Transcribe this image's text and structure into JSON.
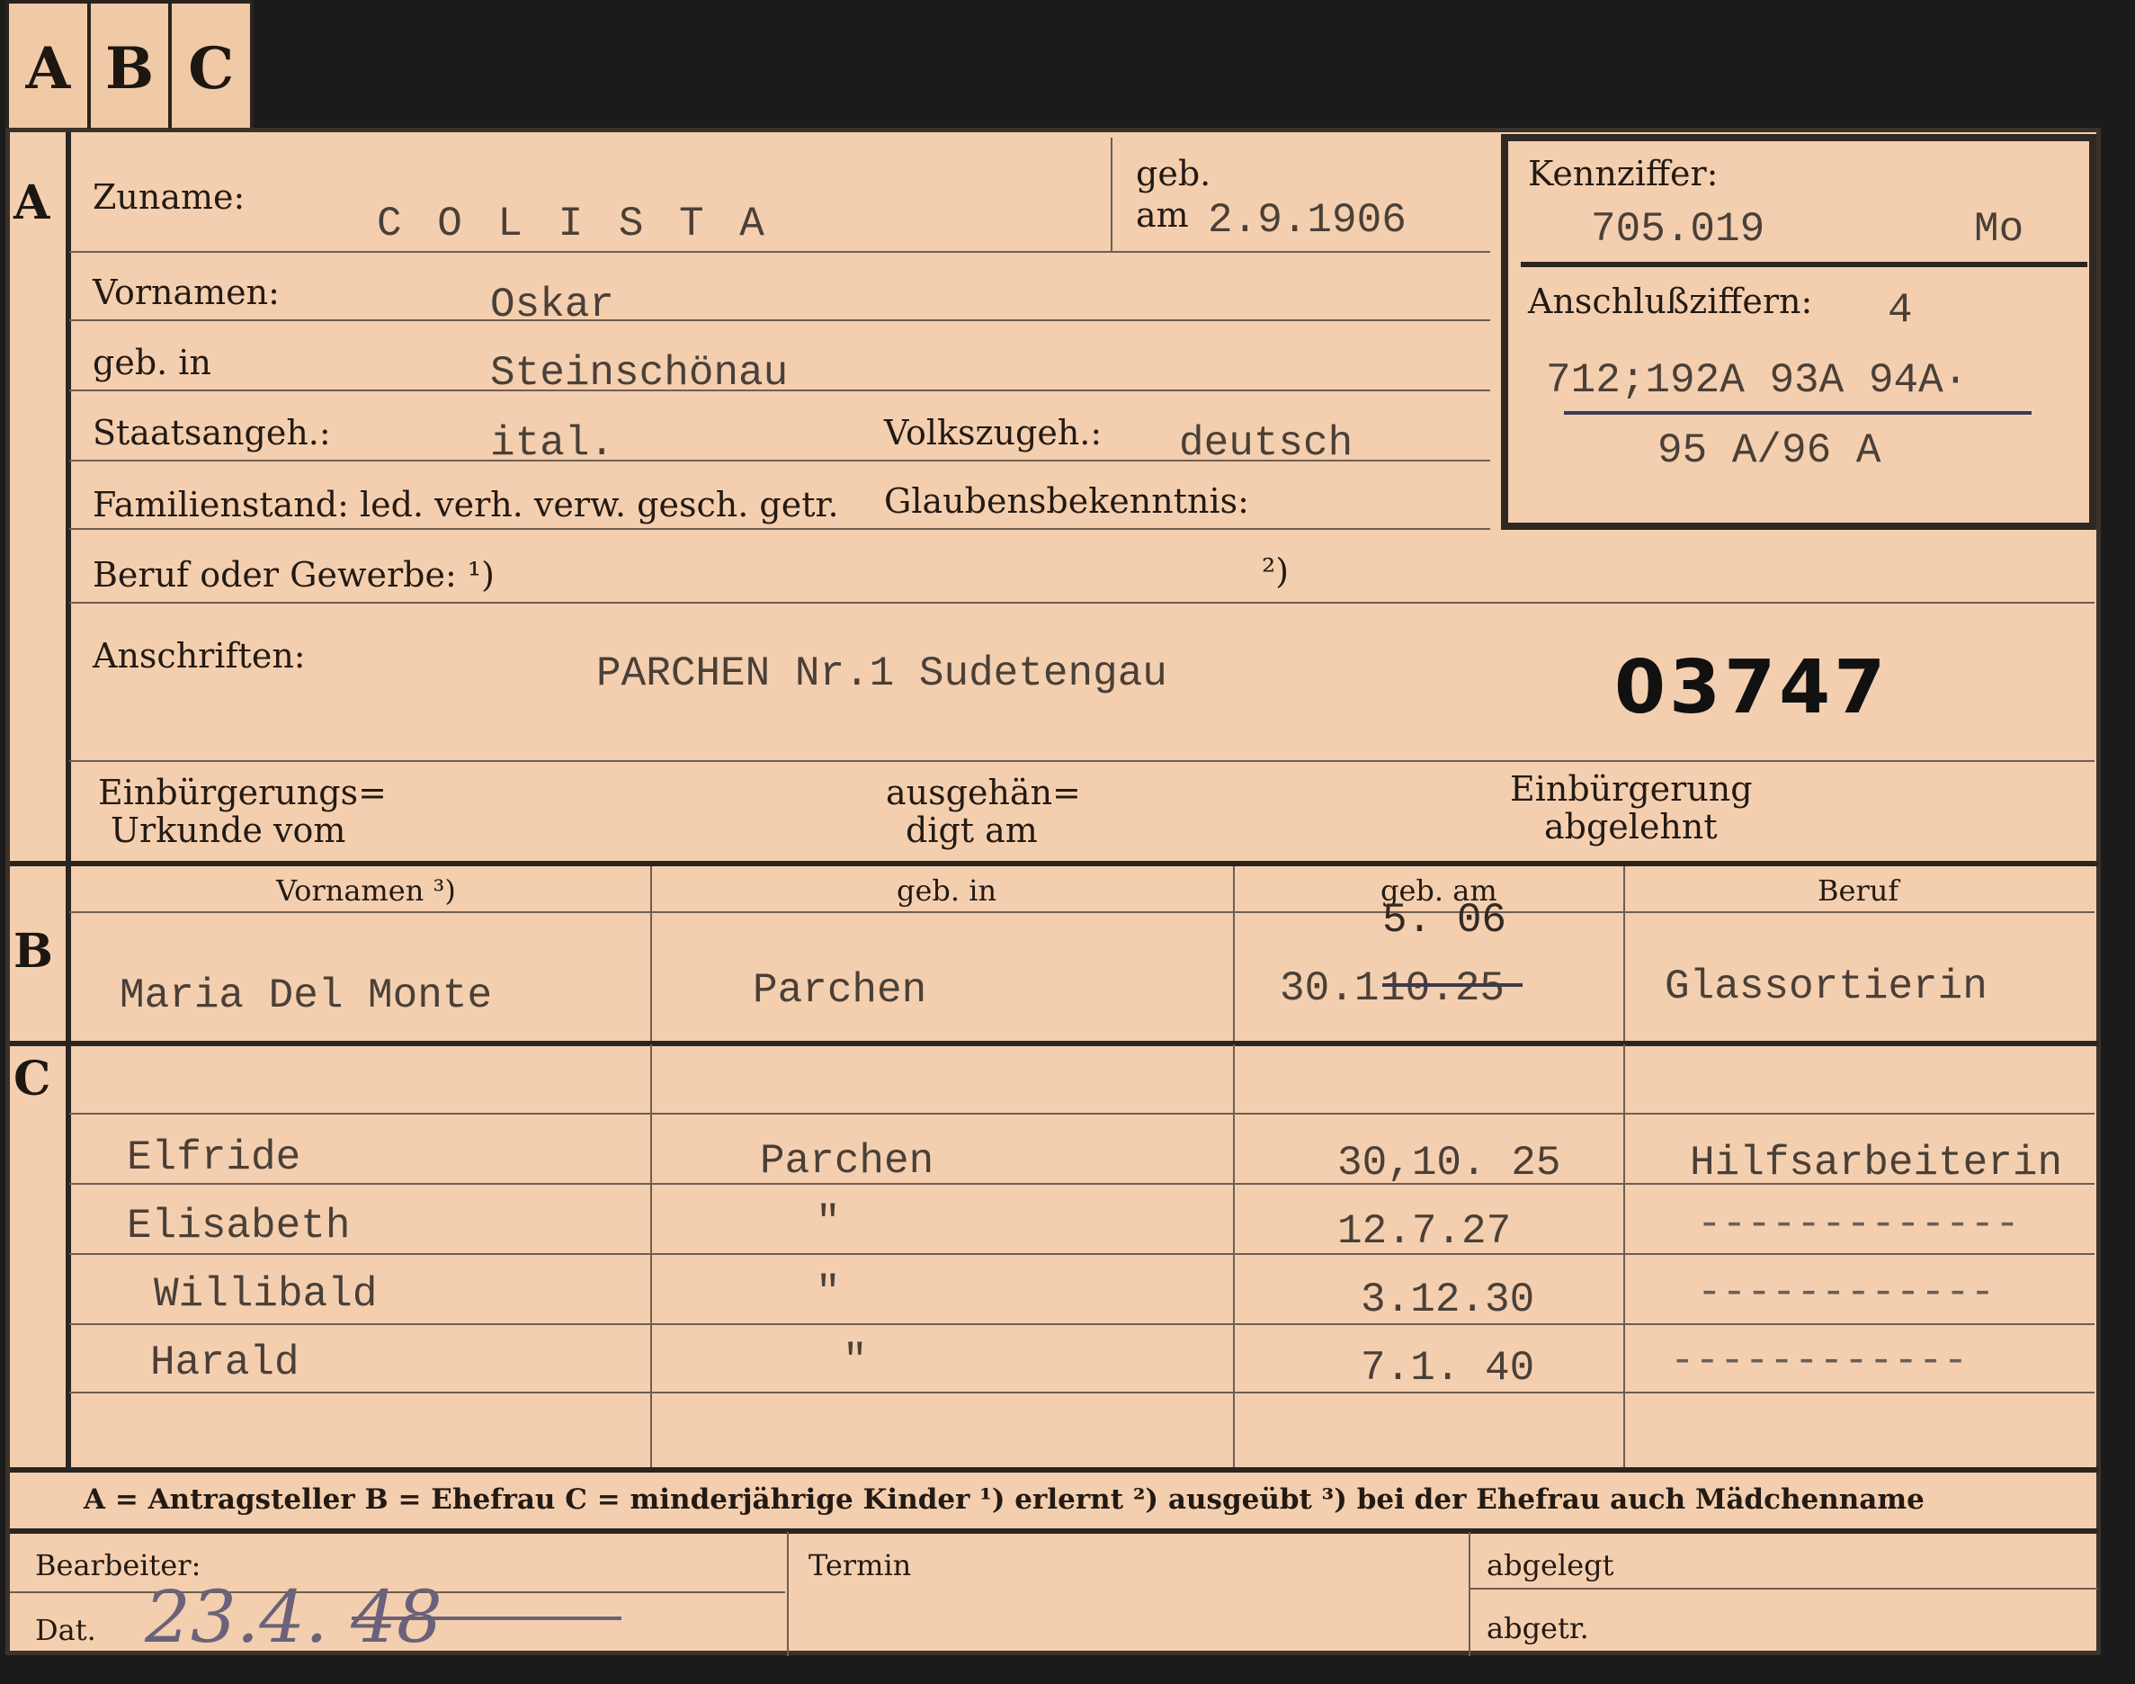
{
  "tabs": [
    "A",
    "B",
    "C"
  ],
  "section_marks": {
    "a": "A",
    "b": "B",
    "c": "C"
  },
  "labels": {
    "zuname": "Zuname:",
    "geb": "geb.",
    "am": "am",
    "vornamen": "Vornamen:",
    "geb_in": "geb. in",
    "staatsangeh": "Staatsangeh.:",
    "volkszugeh": "Volkszugeh.:",
    "familienstand": "Familienstand: led. verh. verw. gesch. getr.",
    "glaubensbekenntnis": "Glaubensbekenntnis:",
    "beruf": "Beruf oder Gewerbe: ¹)",
    "beruf_note2": "²)",
    "anschriften": "Anschriften:",
    "einbuergerungs_1": "Einbürgerungs=",
    "einbuergerungs_2": "Urkunde vom",
    "ausgehaen_1": "ausgehän=",
    "ausgehaen_2": "digt am",
    "abgelehnt_1": "Einbürgerung",
    "abgelehnt_2": "abgelehnt",
    "kennziffer": "Kennziffer:",
    "anschlussziffern": "Anschlußziffern:"
  },
  "person": {
    "zuname": "C O L I S T A",
    "geb_am": "2.9.1906",
    "vornamen": "Oskar",
    "geb_in": "Steinschönau",
    "staatsangeh": "ital.",
    "volkszugeh": "deutsch",
    "anschrift": "PARCHEN Nr.1 Sudetengau",
    "aktenzahl": "03747"
  },
  "kennziffer": {
    "value": "705.019",
    "suffix": "Mo",
    "anschluss_count": "4",
    "line1": "712;192A 93A 94A·",
    "line2": "95 A/96 A"
  },
  "section_b": {
    "headers": [
      "Vornamen ³)",
      "geb. in",
      "geb. am",
      "Beruf"
    ],
    "row": {
      "vornamen": "Maria Del Monte",
      "geb_in": "Parchen",
      "geb_am_correction": "5.  06",
      "geb_am": "30.1",
      "geb_am_struck": "10.25",
      "beruf": "Glassortierin"
    }
  },
  "section_c": {
    "rows": [
      {
        "name": "Elfride",
        "geb_in": "Parchen",
        "geb_am": "30,10. 25",
        "beruf": "Hilfsarbeiterin"
      },
      {
        "name": "Elisabeth",
        "geb_in": "\"",
        "geb_am": "12.7.27",
        "beruf": "-------------"
      },
      {
        "name": "Willibald",
        "geb_in": "\"",
        "geb_am": "3.12.30",
        "beruf": "------------"
      },
      {
        "name": "Harald",
        "geb_in": "\"",
        "geb_am": "7.1. 40",
        "beruf": "------------"
      }
    ]
  },
  "legend": "A = Antragsteller   B = Ehefrau   C = minderjährige Kinder   ¹) erlernt   ²) ausgeübt   ³) bei der Ehefrau auch Mädchenname",
  "footer": {
    "bearbeiter": "Bearbeiter:",
    "dat": "Dat.",
    "dat_value": "23.4. 48",
    "termin": "Termin",
    "abgelegt": "abgelegt",
    "abgetr": "abgetr."
  }
}
